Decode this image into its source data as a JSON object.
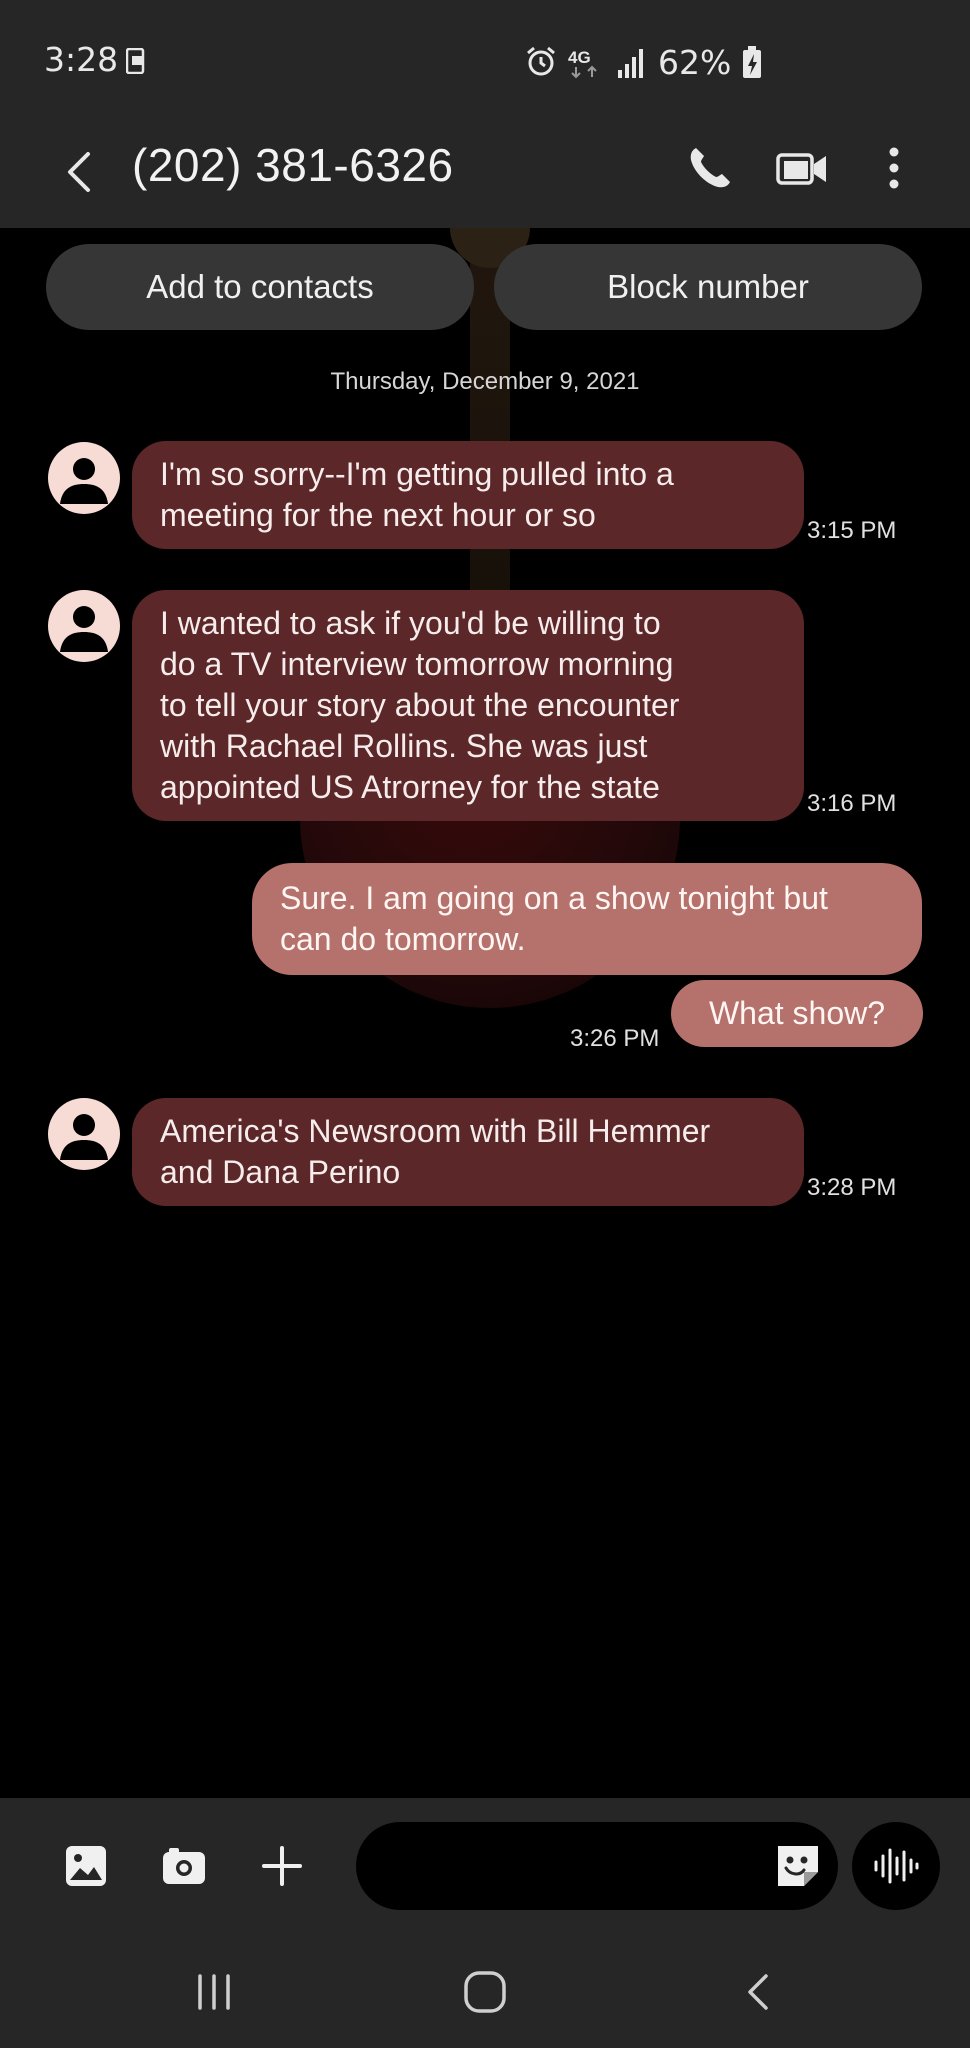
{
  "status_bar": {
    "time": "3:28",
    "battery": "62%",
    "network": "4G"
  },
  "header": {
    "title": "(202) 381-6326",
    "icons": [
      "back-icon",
      "phone-icon",
      "video-call-icon",
      "more-vert-icon"
    ]
  },
  "actions": {
    "add_contact": "Add to contacts",
    "block": "Block number"
  },
  "date_divider": "Thursday, December 9, 2021",
  "messages": [
    {
      "direction": "incoming",
      "lines": [
        "I'm so sorry--I'm getting pulled into a",
        "meeting for the next hour or so"
      ],
      "time": "3:15 PM"
    },
    {
      "direction": "incoming",
      "lines": [
        "I wanted to ask if you'd be willing to",
        "do a TV interview tomorrow morning",
        "to tell your story about the encounter",
        "with Rachael Rollins. She was just",
        "appointed US Atrorney for the state"
      ],
      "time": "3:16 PM"
    },
    {
      "direction": "outgoing",
      "lines": [
        "Sure. I am going on a show tonight but",
        "can do tomorrow."
      ],
      "time": ""
    },
    {
      "direction": "outgoing",
      "lines": [
        "What show?"
      ],
      "time": "3:26 PM"
    },
    {
      "direction": "incoming",
      "lines": [
        "America's Newsroom with Bill Hemmer",
        "and Dana Perino"
      ],
      "time": "3:28 PM"
    }
  ],
  "composer": {
    "placeholder": "",
    "icons": [
      "gallery-icon",
      "camera-icon",
      "add-icon",
      "sticker-icon",
      "voice-record-icon"
    ]
  },
  "navigation": {
    "icons": [
      "recent-apps-icon",
      "home-icon",
      "nav-back-icon"
    ]
  },
  "colors": {
    "incoming_bubble": "#5b2729",
    "outgoing_bubble": "#b5716b",
    "bar": "#262626",
    "avatar": "#f6dcd4"
  }
}
